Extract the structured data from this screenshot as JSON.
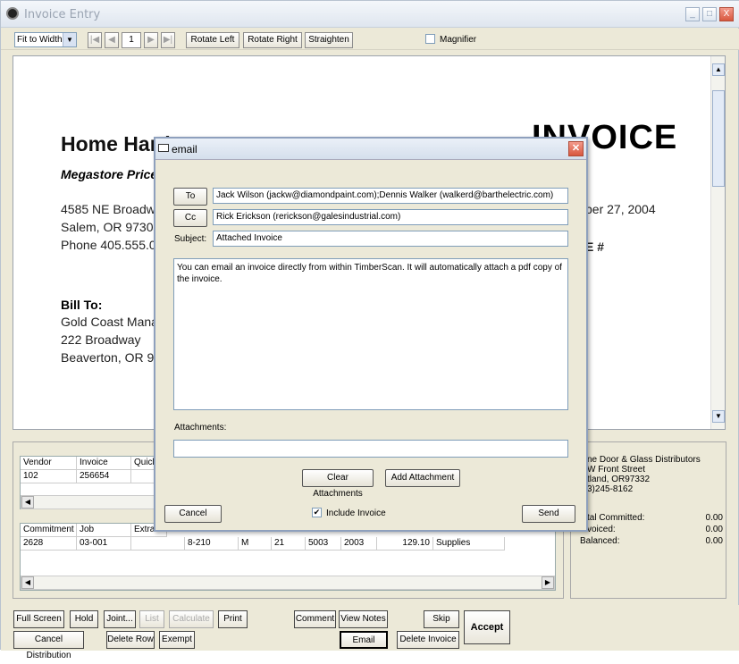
{
  "window": {
    "title": "Invoice Entry",
    "min": "_",
    "max": "□",
    "close": "X"
  },
  "toolbar": {
    "zoom": "Fit to Width",
    "nav_first": "|◀",
    "nav_prev": "◀",
    "page": "1",
    "nav_next": "▶",
    "nav_last": "▶|",
    "rotate_left": "Rotate Left",
    "rotate_right": "Rotate Right",
    "straighten": "Straighten",
    "magnifier": "Magnifier"
  },
  "document": {
    "company": "Home Hardware, Inc",
    "slogan": "Megastore Prices",
    "address1": "4585 NE Broadway",
    "address2": "Salem, OR 97301",
    "phone": "Phone 405.555.01",
    "invoice_heading": "INVOICE",
    "date": "ber 27, 2004",
    "inv_no_label": "E #",
    "bill_to": "Bill To:",
    "bill1": "Gold Coast Manag",
    "bill2": "222 Broadway",
    "bill3": "Beaverton, OR 970"
  },
  "vendor_grid": {
    "headers": [
      "Vendor",
      "Invoice",
      "Quick P"
    ],
    "row": [
      "102",
      "256654",
      ""
    ]
  },
  "dist_grid": {
    "headers": [
      "Commitment",
      "Job",
      "Extra"
    ],
    "row": [
      "2628",
      "03-001",
      "",
      "8-210",
      "M",
      "21",
      "5003",
      "2003",
      "129.10",
      "Supplies"
    ]
  },
  "info_panel": {
    "addr1": "ne Door & Glass Distributors",
    "addr2": "W Front Street",
    "addr3": "tland, OR97332",
    "addr4": "3)245-8162",
    "committed_label": "tal Committed:",
    "committed_value": "0.00",
    "invoiced_label": "voiced:",
    "invoiced_value": "0.00",
    "balanced_label": "Balanced:",
    "balanced_value": "0.00"
  },
  "bottom": {
    "full_screen": "Full Screen",
    "hold": "Hold",
    "joint": "Joint...",
    "list": "List",
    "calculate": "Calculate",
    "print": "Print",
    "comment": "Comment",
    "view_notes": "View Notes",
    "skip": "Skip",
    "accept": "Accept",
    "cancel_dist": "Cancel Distribution",
    "delete_row": "Delete Row",
    "exempt": "Exempt",
    "email": "Email",
    "delete_invoice": "Delete Invoice"
  },
  "email_dialog": {
    "title": "email",
    "to_button": "To",
    "to_value": "Jack Wilson (jackw@diamondpaint.com);Dennis Walker (walkerd@barthelectric.com)",
    "cc_button": "Cc",
    "cc_value": "Rick Erickson (rerickson@galesindustrial.com)",
    "subject_label": "Subject:",
    "subject_value": "Attached Invoice",
    "body": "You can email an invoice directly from within TimberScan. It will automatically attach a pdf copy of the invoice.",
    "attachments_label": "Attachments:",
    "attachments_value": "",
    "clear_attachments": "Clear Attachments",
    "add_attachment": "Add Attachment",
    "cancel": "Cancel",
    "include_invoice": "Include Invoice",
    "include_checked": "✔",
    "send": "Send"
  }
}
